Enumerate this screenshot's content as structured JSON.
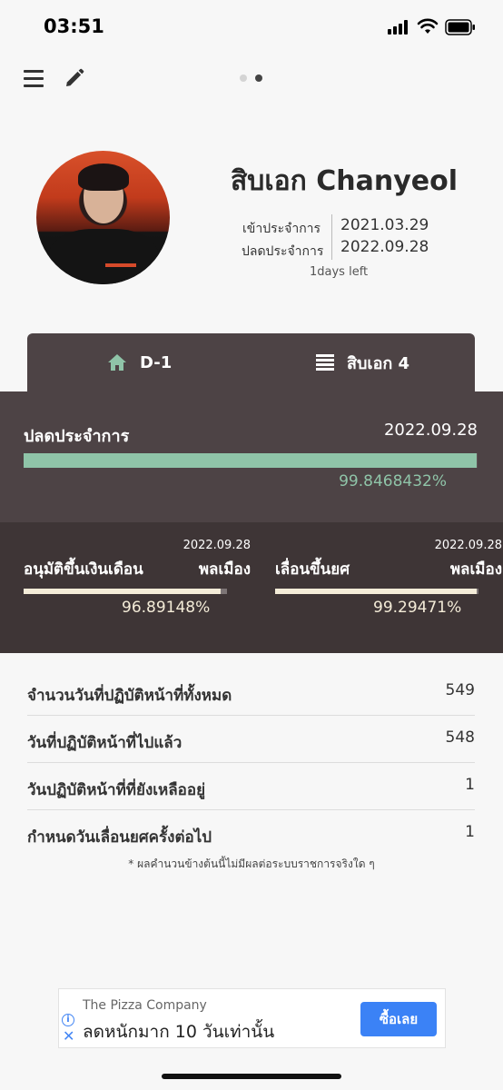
{
  "status_bar": {
    "time": "03:51"
  },
  "profile": {
    "rank_name": "สิบเอก Chanyeol",
    "enlist_label": "เข้าประจำการ",
    "enlist_date": "2021.03.29",
    "discharge_label": "ปลดประจำการ",
    "discharge_date": "2022.09.28",
    "days_left": "1days left"
  },
  "tabs": [
    {
      "label": "D-1",
      "icon": "home-icon"
    },
    {
      "label": "สิบเอก 4",
      "icon": "list-icon"
    }
  ],
  "discharge_progress": {
    "label": "ปลดประจำการ",
    "date": "2022.09.28",
    "percent_text": "99.8468432%",
    "fraction": 0.998468432,
    "color": "#8fc4a8"
  },
  "promotions": [
    {
      "date": "2022.09.28",
      "title": "อนุมัติขึ้นเงินเดือน",
      "rank": "พลเมือง",
      "percent_text": "96.89148%",
      "fraction": 0.9689148
    },
    {
      "date": "2022.09.28",
      "title": "เลื่อนขึ้นยศ",
      "rank": "พลเมือง",
      "percent_text": "99.29471%",
      "fraction": 0.9929471
    }
  ],
  "stats": [
    {
      "label": "จำนวนวันที่ปฏิบัติหน้าที่ทั้งหมด",
      "value": "549"
    },
    {
      "label": "วันที่ปฏิบัติหน้าที่ไปแล้ว",
      "value": "548"
    },
    {
      "label": "วันปฏิบัติหน้าที่ที่ยังเหลืออยู่",
      "value": "1"
    },
    {
      "label": "กำหนดวันเลื่อนยศครั้งต่อไป",
      "value": "1"
    }
  ],
  "disclaimer": "* ผลคำนวนข้างต้นนี้ไม่มีผลต่อระบบราชการจริงใด ๆ",
  "ad": {
    "advertiser": "The Pizza Company",
    "headline": "ลดหนักมาก 10 วันเท่านั้น",
    "cta": "ซื้อเลย"
  },
  "colors": {
    "accent_green": "#8fc4a8",
    "panel_dark": "#4d4345",
    "panel_darker": "#3e3536",
    "cta_blue": "#3b82f6"
  }
}
